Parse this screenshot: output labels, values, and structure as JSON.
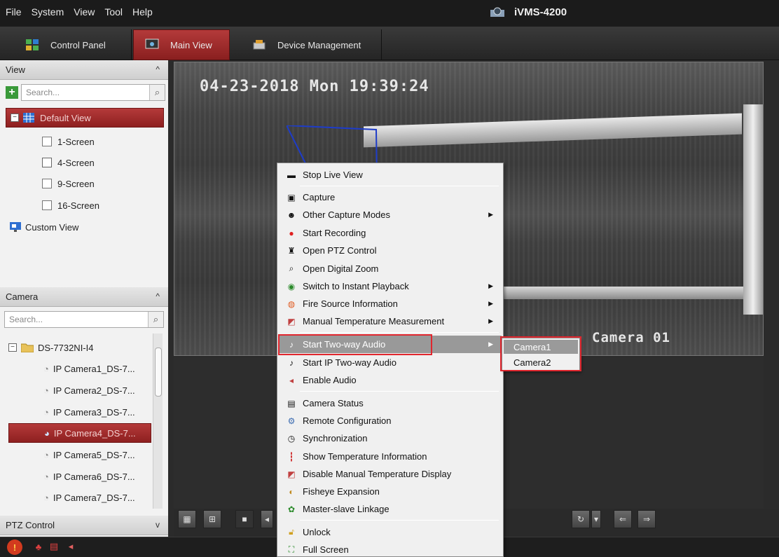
{
  "menubar": {
    "items": [
      "File",
      "System",
      "View",
      "Tool",
      "Help"
    ],
    "app_title": "iVMS-4200"
  },
  "tabs": [
    {
      "label": "Control Panel"
    },
    {
      "label": "Main View"
    },
    {
      "label": "Device Management"
    }
  ],
  "view_panel": {
    "header": "View",
    "search_placeholder": "Search...",
    "items": [
      "Default View",
      "1-Screen",
      "4-Screen",
      "9-Screen",
      "16-Screen",
      "Custom View"
    ]
  },
  "camera_panel": {
    "header": "Camera",
    "search_placeholder": "Search...",
    "device": "DS-7732NI-I4",
    "cameras": [
      "IP Camera1_DS-7...",
      "IP Camera2_DS-7...",
      "IP Camera3_DS-7...",
      "IP Camera4_DS-7...",
      "IP Camera5_DS-7...",
      "IP Camera6_DS-7...",
      "IP Camera7_DS-7..."
    ]
  },
  "ptz_panel": {
    "header": "PTZ Control"
  },
  "video": {
    "timestamp": "04-23-2018 Mon 19:39:24",
    "camera_label": "Camera 01"
  },
  "context_menu": {
    "items": [
      "Stop Live View",
      "Capture",
      "Other Capture Modes",
      "Start Recording",
      "Open PTZ Control",
      "Open Digital Zoom",
      "Switch to Instant Playback",
      "Fire Source Information",
      "Manual Temperature Measurement",
      "Start Two-way Audio",
      "Start IP Two-way Audio",
      "Enable Audio",
      "Camera Status",
      "Remote Configuration",
      "Synchronization",
      "Show Temperature Information",
      "Disable Manual Temperature Display",
      "Fisheye Expansion",
      "Master-slave Linkage",
      "Unlock",
      "Full Screen"
    ],
    "submenu": [
      "Camera1",
      "Camera2"
    ]
  },
  "colors": {
    "accent_red": "#b43a3a",
    "highlight_border": "#e0262e",
    "osd_line": "#1e3cc8"
  }
}
